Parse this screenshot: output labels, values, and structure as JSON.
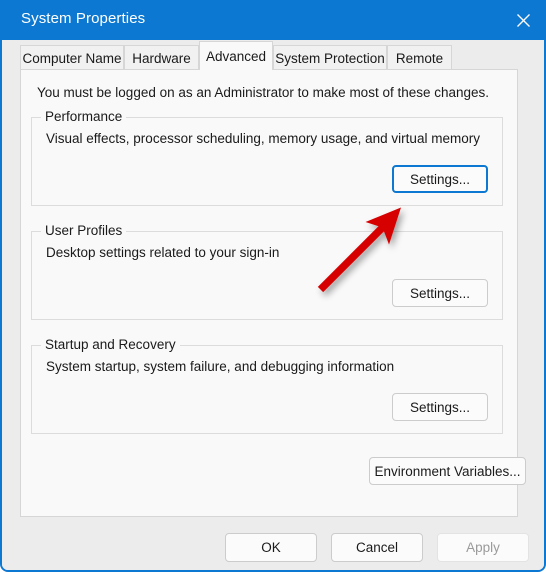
{
  "window": {
    "title": "System Properties",
    "close_icon": "close-icon",
    "accent_color": "#0d78d1",
    "titlebar_text_color": "#ffffff",
    "panel_background": "#f9f9f9",
    "bottombar_background": "#ececec"
  },
  "tabs": [
    {
      "label": "Computer Name",
      "selected": false
    },
    {
      "label": "Hardware",
      "selected": false
    },
    {
      "label": "Advanced",
      "selected": true
    },
    {
      "label": "System Protection",
      "selected": false
    },
    {
      "label": "Remote",
      "selected": false
    }
  ],
  "panel": {
    "notice": "You must be logged on as an Administrator to make most of these changes.",
    "groups": [
      {
        "legend": "Performance",
        "description": "Visual effects, processor scheduling, memory usage, and virtual memory",
        "button_label": "Settings...",
        "button_focused": true
      },
      {
        "legend": "User Profiles",
        "description": "Desktop settings related to your sign-in",
        "button_label": "Settings...",
        "button_focused": false
      },
      {
        "legend": "Startup and Recovery",
        "description": "System startup, system failure, and debugging information",
        "button_label": "Settings...",
        "button_focused": false
      }
    ],
    "environment_variables_label": "Environment Variables..."
  },
  "footer": {
    "ok_label": "OK",
    "cancel_label": "Cancel",
    "apply_label": "Apply",
    "apply_disabled": true
  },
  "annotation": {
    "arrow_color": "#d60000",
    "description": "red-arrow pointing to Performance Settings button"
  }
}
